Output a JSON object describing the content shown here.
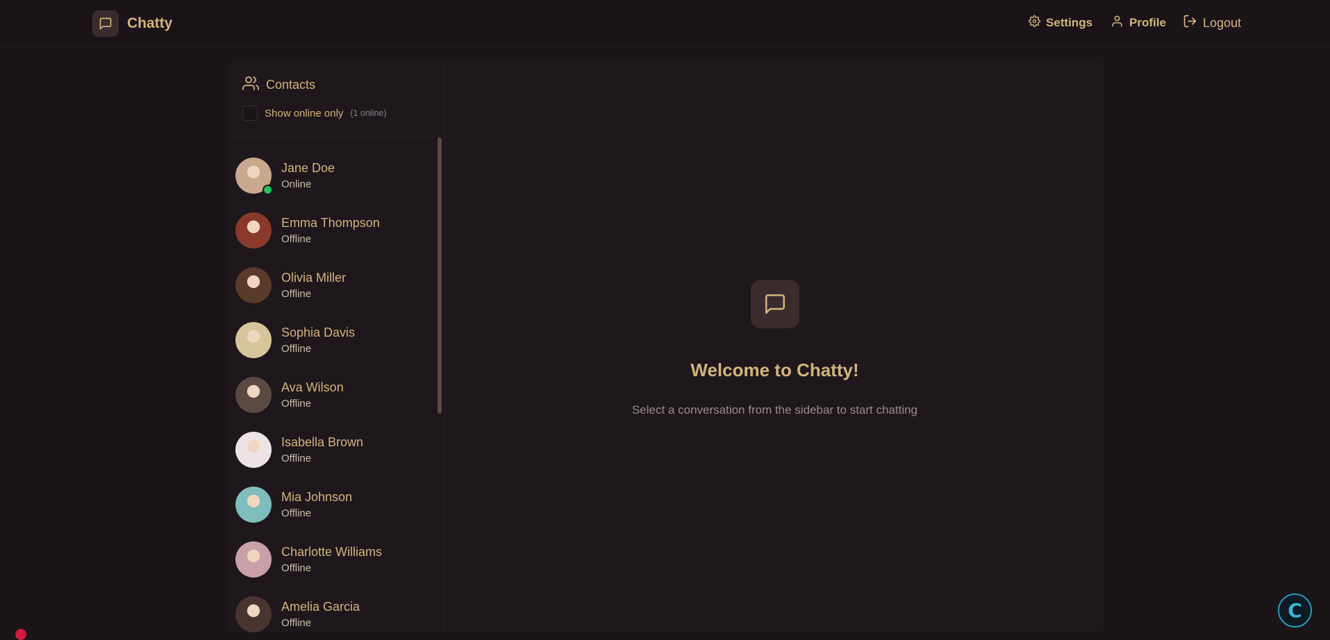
{
  "app": {
    "name": "Chatty",
    "icon": "message-square-icon",
    "accent_color": "#d4b47c",
    "online_color": "#22c55e"
  },
  "nav": {
    "settings_label": "Settings",
    "profile_label": "Profile",
    "logout_label": "Logout"
  },
  "sidebar": {
    "title": "Contacts",
    "title_icon": "users-icon",
    "filter_label": "Show online only",
    "filter_checked": false,
    "online_count": "(1 online)",
    "contacts": [
      {
        "name": "Jane Doe",
        "status": "Online",
        "online": true,
        "avatar_color": "#c8a98e"
      },
      {
        "name": "Emma Thompson",
        "status": "Offline",
        "online": false,
        "avatar_color": "#8a3a2a"
      },
      {
        "name": "Olivia Miller",
        "status": "Offline",
        "online": false,
        "avatar_color": "#5a3a28"
      },
      {
        "name": "Sophia Davis",
        "status": "Offline",
        "online": false,
        "avatar_color": "#d8c49a"
      },
      {
        "name": "Ava Wilson",
        "status": "Offline",
        "online": false,
        "avatar_color": "#5b4a44"
      },
      {
        "name": "Isabella Brown",
        "status": "Offline",
        "online": false,
        "avatar_color": "#ece4e4"
      },
      {
        "name": "Mia Johnson",
        "status": "Offline",
        "online": false,
        "avatar_color": "#7fbcbc"
      },
      {
        "name": "Charlotte Williams",
        "status": "Offline",
        "online": false,
        "avatar_color": "#c9a0a8"
      },
      {
        "name": "Amelia Garcia",
        "status": "Offline",
        "online": false,
        "avatar_color": "#4a3430"
      }
    ]
  },
  "welcome": {
    "icon": "message-square-icon",
    "title": "Welcome to Chatty!",
    "subtitle": "Select a conversation from the sidebar to start chatting"
  }
}
